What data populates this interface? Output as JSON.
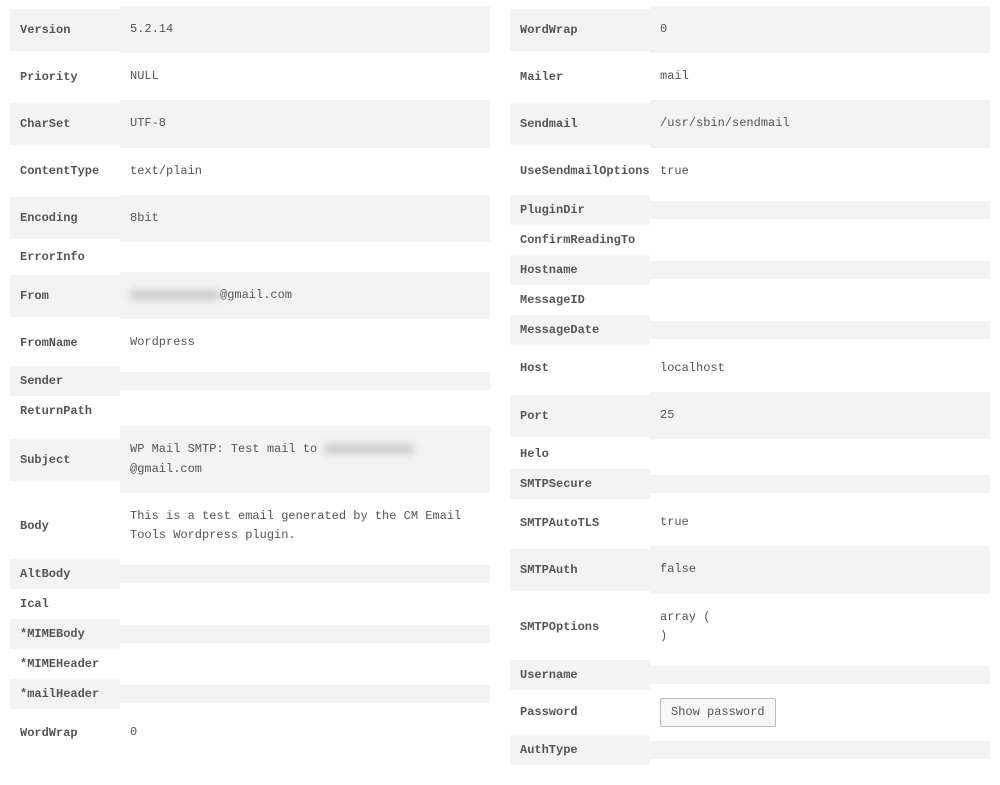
{
  "left": {
    "rows": [
      {
        "k": "Version",
        "v": "5.2.14",
        "tall": true
      },
      {
        "k": "Priority",
        "v": "NULL",
        "tall": true
      },
      {
        "k": "CharSet",
        "v": "UTF-8",
        "tall": true
      },
      {
        "k": "ContentType",
        "v": "text/plain",
        "tall": true
      },
      {
        "k": "Encoding",
        "v": "8bit",
        "tall": true
      },
      {
        "k": "ErrorInfo",
        "v": ""
      },
      {
        "k": "From",
        "v": "@gmail.com",
        "blur_before": true,
        "tall": true
      },
      {
        "k": "FromName",
        "v": "Wordpress",
        "tall": true
      },
      {
        "k": "Sender",
        "v": ""
      },
      {
        "k": "ReturnPath",
        "v": ""
      },
      {
        "k": "Subject",
        "v_prefix": "WP Mail SMTP: Test mail to ",
        "v_suffix": "@gmail.com",
        "blur_mid": true,
        "tall": true
      },
      {
        "k": "Body",
        "v": "This is a test email generated by the CM Email Tools Wordpress plugin.",
        "tall": true
      },
      {
        "k": "AltBody",
        "v": ""
      },
      {
        "k": "Ical",
        "v": ""
      },
      {
        "k": "*MIMEBody",
        "v": ""
      },
      {
        "k": "*MIMEHeader",
        "v": ""
      },
      {
        "k": "*mailHeader",
        "v": ""
      },
      {
        "k": "WordWrap",
        "v": "0",
        "tall": true
      }
    ]
  },
  "right": {
    "rows": [
      {
        "k": "WordWrap",
        "v": "0",
        "tall": true
      },
      {
        "k": "Mailer",
        "v": "mail",
        "tall": true
      },
      {
        "k": "Sendmail",
        "v": "/usr/sbin/sendmail",
        "tall": true
      },
      {
        "k": "UseSendmailOptions",
        "v": "true",
        "tall": true
      },
      {
        "k": "PluginDir",
        "v": ""
      },
      {
        "k": "ConfirmReadingTo",
        "v": ""
      },
      {
        "k": "Hostname",
        "v": ""
      },
      {
        "k": "MessageID",
        "v": ""
      },
      {
        "k": "MessageDate",
        "v": ""
      },
      {
        "k": "Host",
        "v": "localhost",
        "tall": true
      },
      {
        "k": "Port",
        "v": "25",
        "tall": true
      },
      {
        "k": "Helo",
        "v": ""
      },
      {
        "k": "SMTPSecure",
        "v": ""
      },
      {
        "k": "SMTPAutoTLS",
        "v": "true",
        "tall": true
      },
      {
        "k": "SMTPAuth",
        "v": "false",
        "tall": true
      },
      {
        "k": "SMTPOptions",
        "v": "array (\n)",
        "tall": true
      },
      {
        "k": "Username",
        "v": ""
      },
      {
        "k": "Password",
        "v": "",
        "button": "Show password"
      },
      {
        "k": "AuthType",
        "v": ""
      }
    ]
  },
  "buttons": {
    "show_password": "Show password"
  }
}
